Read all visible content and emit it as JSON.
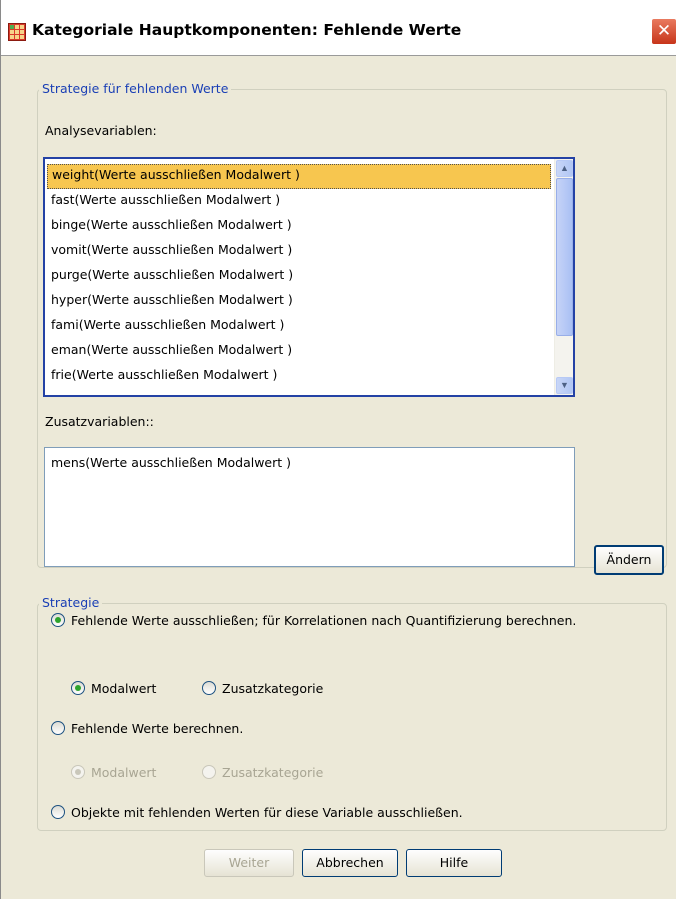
{
  "window": {
    "title": "Kategoriale Hauptkomponenten: Fehlende Werte",
    "close_glyph": "✕"
  },
  "strategy_group": {
    "legend": "Strategie für fehlenden Werte",
    "analysis_label": "Analysevariablen:",
    "analysis_items": [
      "weight(Werte ausschließen Modalwert )",
      "fast(Werte ausschließen Modalwert )",
      "binge(Werte ausschließen Modalwert )",
      "vomit(Werte ausschließen Modalwert )",
      "purge(Werte ausschließen Modalwert )",
      "hyper(Werte ausschließen Modalwert )",
      "fami(Werte ausschließen Modalwert )",
      "eman(Werte ausschließen Modalwert )",
      "frie(Werte ausschließen Modalwert )"
    ],
    "supplementary_label": "Zusatzvariablen::",
    "supplementary_items": [
      "mens(Werte ausschließen Modalwert )"
    ]
  },
  "change_button": "Ändern",
  "strategie_group": {
    "legend": "Strategie",
    "option_exclude": "Fehlende Werte ausschließen; für Korrelationen nach Quantifizierung berechnen.",
    "exclude_sub": {
      "modal": "Modalwert",
      "extra_category": "Zusatzkategorie"
    },
    "option_impute": "Fehlende Werte berechnen.",
    "impute_sub": {
      "modal": "Modalwert",
      "extra_category": "Zusatzkategorie"
    },
    "option_exclude_objects": "Objekte mit fehlenden Werten für diese Variable ausschließen."
  },
  "buttons": {
    "continue": "Weiter",
    "cancel": "Abbrechen",
    "help": "Hilfe"
  },
  "icons": {
    "scroll_up": "▲",
    "scroll_down": "▼"
  },
  "colors": {
    "selection": "#f7c64f",
    "group_title": "#1a3fb5",
    "dialog_bg": "#ece9d8"
  }
}
